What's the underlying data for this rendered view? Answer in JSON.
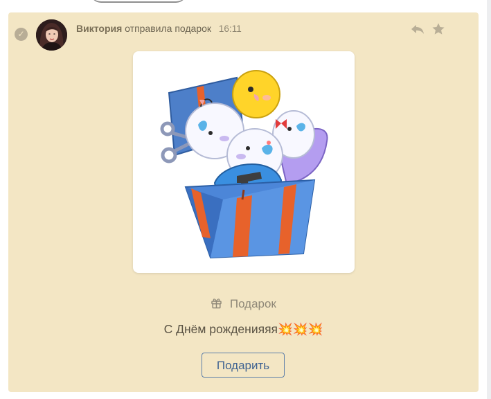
{
  "message": {
    "sender_name": "Виктория",
    "action_text": "отправила подарок",
    "time": "16:11",
    "icons": {
      "status": "check-circle-icon",
      "reply": "reply-icon",
      "favorite": "star-icon"
    }
  },
  "gift": {
    "image": "gift-box-parrots-sticker",
    "label": "Подарок",
    "label_icon": "gift-icon",
    "message_text": "С Днём рожденияяя💥💥💥",
    "send_button_label": "Подарить"
  },
  "colors": {
    "message_bg": "#f3e6c4",
    "button_border": "#5b7da8",
    "button_text": "#3f6391"
  }
}
